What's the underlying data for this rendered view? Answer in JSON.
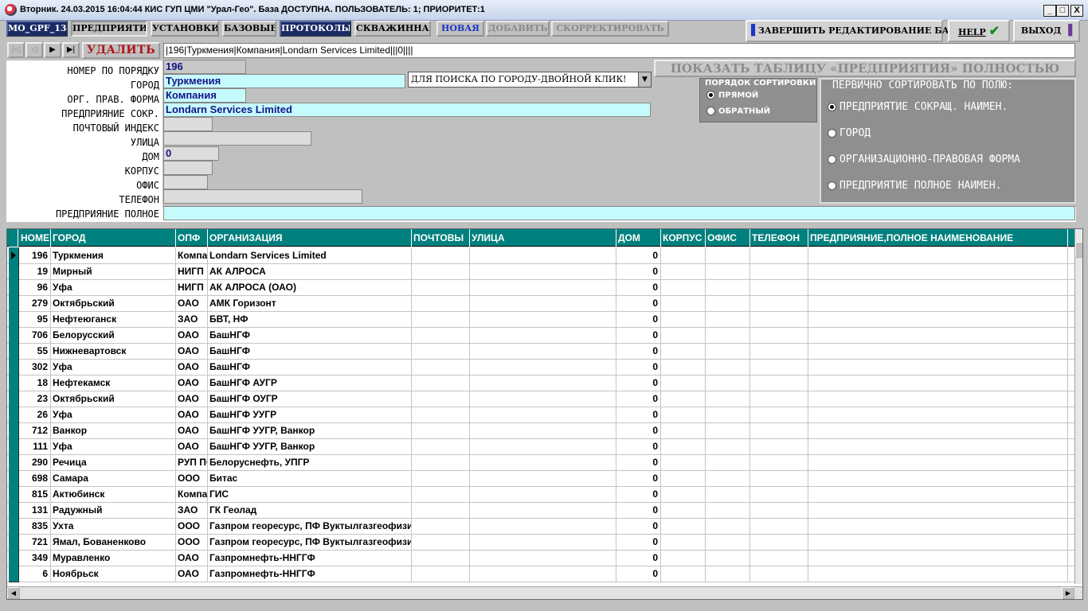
{
  "window": {
    "title": "Вторник. 24.03.2015 16:04:44 КИС ГУП ЦМИ \"Урал-Гео\". База ДОСТУПНА. ПОЛЬЗОВАТЕЛЬ: 1; ПРИОРИТЕТ:1",
    "minimize": "_",
    "maximize": "□",
    "close": "X"
  },
  "toolbar": {
    "db_label": "MO_GPF_13",
    "enterprises": "ПРЕДПРИЯТИЯ",
    "settings": "УСТАНОВКИ",
    "base": "БАЗОВЫЕ",
    "protocols": "ПРОТОКОЛЫ",
    "well": "СКВАЖИННАЯ",
    "new": "НОВАЯ",
    "add": "ДОБАВИТЬ",
    "correct": "СКОРРЕКТИРОВАТЬ",
    "finish_editing": "ЗАВЕРШИТЬ РЕДАКТИРОВАНИЕ БАЗЫ",
    "help": "HELP",
    "exit": "ВЫХОД"
  },
  "nav": {
    "first": "|◁",
    "prev": "◁",
    "next": "▶",
    "last": "▶|",
    "delete": "УДАЛИТЬ :",
    "record_string": "|196|Туркмения|Компания|Londarn Services Limited|||0||||"
  },
  "form": {
    "labels": {
      "number": "НОМЕР ПО ПОРЯДКУ",
      "city": "ГОРОД",
      "legal_form": "ОРГ. ПРАВ. ФОРМА",
      "short_name": "ПРЕДПРИЯНИЕ СОКР.",
      "postcode": "ПОЧТОВЫЙ ИНДЕКС",
      "street": "УЛИЦА",
      "house": "ДОМ",
      "building": "КОРПУС",
      "office": "ОФИС",
      "phone": "ТЕЛЕФОН",
      "full_name": "ПРЕДПРИЯНИЕ ПОЛНОЕ"
    },
    "values": {
      "number": "196",
      "city": "Туркмения",
      "legal_form": "Компания",
      "short_name": "Londarn Services Limited",
      "postcode": "",
      "street": "",
      "house": "0",
      "building": "",
      "office": "",
      "phone": "",
      "full_name": ""
    },
    "city_search": "ДЛЯ ПОИСКА ПО ГОРОДУ-ДВОЙНОЙ КЛИК!",
    "combo_arrow": "▼"
  },
  "show_full_table": "ПОКАЗАТЬ ТАБЛИЦУ «ПРЕДПРИЯТИЯ» ПОЛНОСТЬЮ",
  "sort_order": {
    "title": "ПОРЯДОК СОРТИРОВКИ :",
    "direct": "ПРЯМОЙ",
    "reverse": "ОБРАТНЫЙ",
    "selected": "direct"
  },
  "sort_field": {
    "title": "ПЕРВИЧНО СОРТИРОВАТЬ ПО ПОЛЮ:",
    "options": [
      "ПРЕДПРИЯТИЕ СОКРАЩ. НАИМЕН.",
      "ГОРОД",
      "ОРГАНИЗАЦИОННО-ПРАВОВАЯ ФОРМА",
      "ПРЕДПРИЯТИЕ ПОЛНОЕ  НАИМЕН."
    ],
    "selected_index": 0
  },
  "grid": {
    "columns": [
      "НОМЕ",
      "ГОРОД",
      "ОПФ",
      "ОРГАНИЗАЦИЯ",
      "ПОЧТОВЫ",
      "УЛИЦА",
      "ДОМ",
      "КОРПУС",
      "ОФИС",
      "ТЕЛЕФОН",
      "ПРЕДПРИЯНИЕ,ПОЛНОЕ НАИМЕНОВАНИЕ"
    ],
    "rows": [
      [
        "196",
        "Туркмения",
        "Компания",
        "Londarn Services Limited",
        "",
        "",
        "0",
        "",
        "",
        "",
        ""
      ],
      [
        "19",
        "Мирный",
        "НИГП",
        "АК АЛРОСА",
        "",
        "",
        "0",
        "",
        "",
        "",
        ""
      ],
      [
        "96",
        "Уфа",
        "НИГП",
        "АК АЛРОСА (ОАО)",
        "",
        "",
        "0",
        "",
        "",
        "",
        ""
      ],
      [
        "279",
        "Октябрьский",
        "ОАО",
        "АМК Горизонт",
        "",
        "",
        "0",
        "",
        "",
        "",
        ""
      ],
      [
        "95",
        "Нефтеюганск",
        "ЗАО",
        "БВТ, НФ",
        "",
        "",
        "0",
        "",
        "",
        "",
        ""
      ],
      [
        "706",
        "Белорусский",
        "ОАО",
        "БашНГФ",
        "",
        "",
        "0",
        "",
        "",
        "",
        ""
      ],
      [
        "55",
        "Нижневартовск",
        "ОАО",
        "БашНГФ",
        "",
        "",
        "0",
        "",
        "",
        "",
        ""
      ],
      [
        "302",
        "Уфа",
        "ОАО",
        "БашНГФ",
        "",
        "",
        "0",
        "",
        "",
        "",
        ""
      ],
      [
        "18",
        "Нефтекамск",
        "ОАО",
        "БашНГФ АУГР",
        "",
        "",
        "0",
        "",
        "",
        "",
        ""
      ],
      [
        "23",
        "Октябрьский",
        "ОАО",
        "БашНГФ ОУГР",
        "",
        "",
        "0",
        "",
        "",
        "",
        ""
      ],
      [
        "26",
        "Уфа",
        "ОАО",
        "БашНГФ УУГР",
        "",
        "",
        "0",
        "",
        "",
        "",
        ""
      ],
      [
        "712",
        "Ванкор",
        "ОАО",
        "БашНГФ УУГР, Ванкор",
        "",
        "",
        "0",
        "",
        "",
        "",
        ""
      ],
      [
        "111",
        "Уфа",
        "ОАО",
        "БашНГФ УУГР, Ванкор",
        "",
        "",
        "0",
        "",
        "",
        "",
        ""
      ],
      [
        "290",
        "Речица",
        "РУП ПО",
        "Белоруснефть, УПГР",
        "",
        "",
        "0",
        "",
        "",
        "",
        ""
      ],
      [
        "698",
        "Самара",
        "ООО",
        "Битас",
        "",
        "",
        "0",
        "",
        "",
        "",
        ""
      ],
      [
        "815",
        "Актюбинск",
        "Компания",
        "ГИС",
        "",
        "",
        "0",
        "",
        "",
        "",
        ""
      ],
      [
        "131",
        "Радужный",
        "ЗАО",
        "ГК Геолад",
        "",
        "",
        "0",
        "",
        "",
        "",
        ""
      ],
      [
        "835",
        "Ухта",
        "ООО",
        "Газпром георесурс, ПФ Вуктылгазгеофизика",
        "",
        "",
        "0",
        "",
        "",
        "",
        ""
      ],
      [
        "721",
        "Ямал, Бованенково",
        "ООО",
        "Газпром георесурс, ПФ Вуктылгазгеофизика",
        "",
        "",
        "0",
        "",
        "",
        "",
        ""
      ],
      [
        "349",
        "Муравленко",
        "ОАО",
        "Газпромнефть-ННГГФ",
        "",
        "",
        "0",
        "",
        "",
        "",
        ""
      ],
      [
        "6",
        "Ноябрьск",
        "ОАО",
        "Газпромнефть-ННГГФ",
        "",
        "",
        "0",
        "",
        "",
        "",
        ""
      ]
    ],
    "current_row": 0
  },
  "colors": {
    "grid_header": "#00807e",
    "form_cyan": "#c6fbfd",
    "delete_red": "#b0151b",
    "new_blue": "#1c35c4"
  }
}
